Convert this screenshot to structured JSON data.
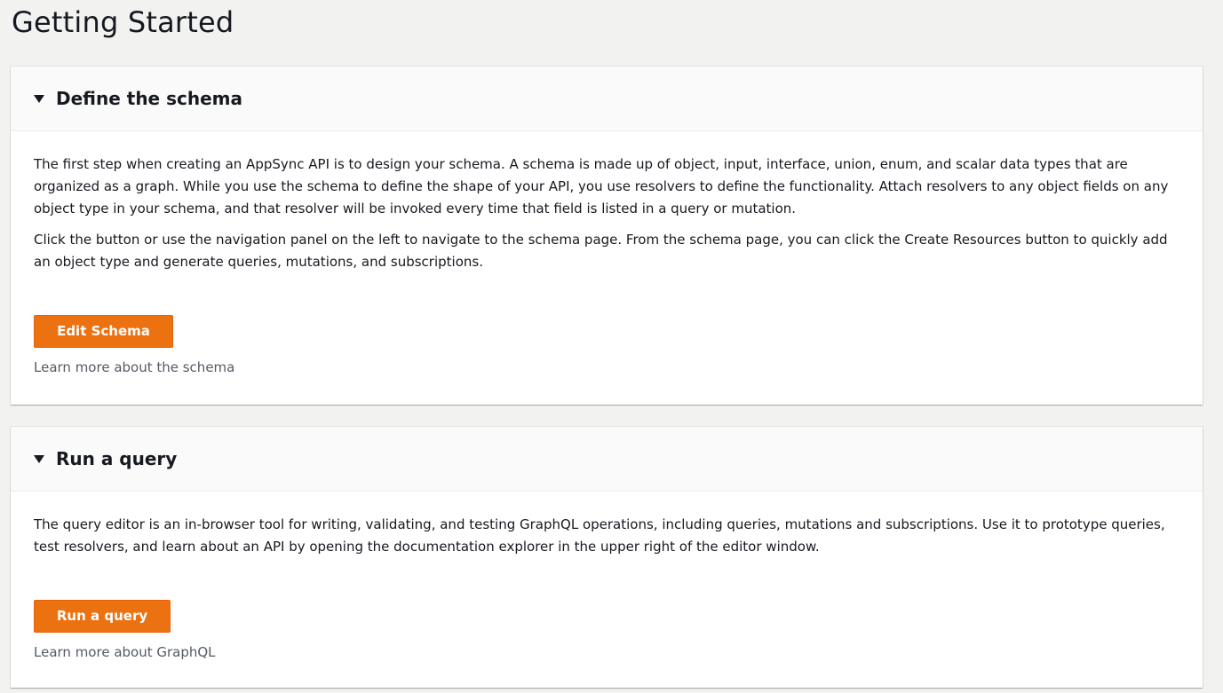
{
  "page": {
    "title": "Getting Started"
  },
  "sections": [
    {
      "title": "Define the schema",
      "paragraphs": [
        "The first step when creating an AppSync API is to design your schema. A schema is made up of object, input, interface, union, enum, and scalar data types that are organized as a graph. While you use the schema to define the shape of your API, you use resolvers to define the functionality. Attach resolvers to any object fields on any object type in your schema, and that resolver will be invoked every time that field is listed in a query or mutation.",
        "Click the button or use the navigation panel on the left to navigate to the schema page. From the schema page, you can click the Create Resources button to quickly add an object type and generate queries, mutations, and subscriptions."
      ],
      "button_label": "Edit Schema",
      "learn_more": "Learn more about the schema",
      "expanded_icon": "caret-down-icon"
    },
    {
      "title": "Run a query",
      "paragraphs": [
        "The query editor is an in-browser tool for writing, validating, and testing GraphQL operations, including queries, mutations and subscriptions. Use it to prototype queries, test resolvers, and learn about an API by opening the documentation explorer in the upper right of the editor window."
      ],
      "button_label": "Run a query",
      "learn_more": "Learn more about GraphQL",
      "expanded_icon": "caret-down-icon"
    }
  ],
  "colors": {
    "background": "#f2f2f1",
    "card": "#ffffff",
    "card_header": "#fafafa",
    "primary_button": "#ec7211",
    "text": "#16191f",
    "secondary_text": "#545b64"
  }
}
